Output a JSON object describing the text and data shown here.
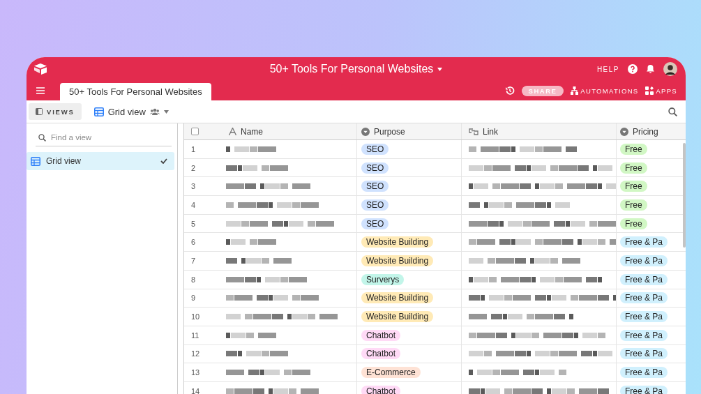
{
  "window": {
    "title": "50+ Tools For Personal Websites"
  },
  "header": {
    "help": "HELP",
    "base_tab": {
      "label": "50+ Tools For Personal Websites",
      "selected": true
    },
    "share": "SHARE",
    "automations": "AUTOMATIONS",
    "apps": "APPS"
  },
  "toolbar": {
    "views_button": "VIEWS",
    "current_view": "Grid view"
  },
  "sidebar": {
    "search": {
      "placeholder": "Find a view"
    },
    "items": [
      {
        "label": "Grid view",
        "selected": true
      }
    ]
  },
  "table": {
    "select_all": {
      "checked": false
    },
    "columns": [
      {
        "label": "Name",
        "kind": "text"
      },
      {
        "label": "Purpose",
        "kind": "select"
      },
      {
        "label": "Link",
        "kind": "link"
      },
      {
        "label": "Pricing",
        "kind": "select"
      }
    ],
    "rows": [
      {
        "number": "1",
        "purpose": {
          "label": "SEO",
          "color": "#d0e2fe"
        },
        "pricing": {
          "label": "Free",
          "color": "#d1f7c4"
        }
      },
      {
        "number": "2",
        "purpose": {
          "label": "SEO",
          "color": "#d0e2fe"
        },
        "pricing": {
          "label": "Free",
          "color": "#d1f7c4"
        }
      },
      {
        "number": "3",
        "purpose": {
          "label": "SEO",
          "color": "#d0e2fe"
        },
        "pricing": {
          "label": "Free",
          "color": "#d1f7c4"
        }
      },
      {
        "number": "4",
        "purpose": {
          "label": "SEO",
          "color": "#d0e2fe"
        },
        "pricing": {
          "label": "Free",
          "color": "#d1f7c4"
        }
      },
      {
        "number": "5",
        "purpose": {
          "label": "SEO",
          "color": "#d0e2fe"
        },
        "pricing": {
          "label": "Free",
          "color": "#d1f7c4"
        }
      },
      {
        "number": "6",
        "purpose": {
          "label": "Website Building",
          "color": "#ffeab6"
        },
        "pricing": {
          "label": "Free & Pa",
          "color": "#d0f0fd"
        }
      },
      {
        "number": "7",
        "purpose": {
          "label": "Website Building",
          "color": "#ffeab6"
        },
        "pricing": {
          "label": "Free & Pa",
          "color": "#d0f0fd"
        }
      },
      {
        "number": "8",
        "purpose": {
          "label": "Surverys",
          "color": "#c2f5e9"
        },
        "pricing": {
          "label": "Free & Pa",
          "color": "#d0f0fd"
        }
      },
      {
        "number": "9",
        "purpose": {
          "label": "Website Building",
          "color": "#ffeab6"
        },
        "pricing": {
          "label": "Free & Pa",
          "color": "#d0f0fd"
        }
      },
      {
        "number": "10",
        "purpose": {
          "label": "Website Building",
          "color": "#ffeab6"
        },
        "pricing": {
          "label": "Free & Pa",
          "color": "#d0f0fd"
        }
      },
      {
        "number": "11",
        "purpose": {
          "label": "Chatbot",
          "color": "#ffdaf6"
        },
        "pricing": {
          "label": "Free & Pa",
          "color": "#d0f0fd"
        }
      },
      {
        "number": "12",
        "purpose": {
          "label": "Chatbot",
          "color": "#ffdaf6"
        },
        "pricing": {
          "label": "Free & Pa",
          "color": "#d0f0fd"
        }
      },
      {
        "number": "13",
        "purpose": {
          "label": "E-Commerce",
          "color": "#fee2d5"
        },
        "pricing": {
          "label": "Free & Pa",
          "color": "#d0f0fd"
        }
      },
      {
        "number": "14",
        "purpose": {
          "label": "Chatbot",
          "color": "#ffdaf6"
        },
        "pricing": {
          "label": "Free & Pa",
          "color": "#d0f0fd"
        }
      }
    ]
  }
}
